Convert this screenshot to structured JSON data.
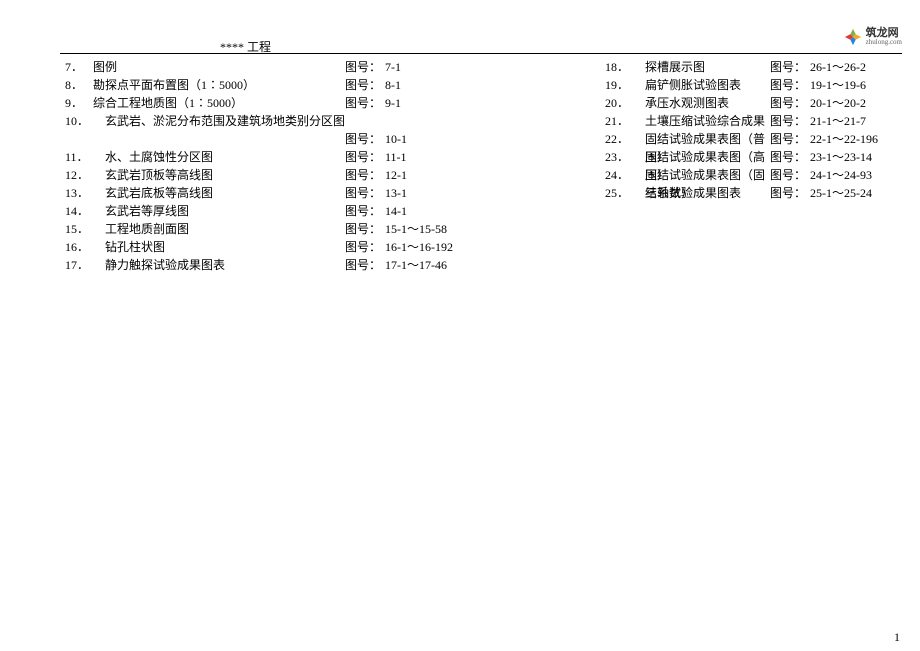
{
  "header": {
    "project_title": "**** 工程"
  },
  "logo": {
    "main": "筑龙网",
    "sub": "zhulong.com"
  },
  "page_number": "1",
  "figno_label": "图号：",
  "left_items": [
    {
      "idx": "7．",
      "title": "图例",
      "figno": "7-1"
    },
    {
      "idx": "8．",
      "title": "勘探点平面布置图（1∶5000）",
      "figno": "8-1"
    },
    {
      "idx": "9．",
      "title": "综合工程地质图（1∶5000）",
      "figno": "9-1"
    },
    {
      "idx": "10．",
      "title": "玄武岩、淤泥分布范围及建筑场地类别分区图",
      "figno": ""
    },
    {
      "idx": "",
      "title": "",
      "figno": "10-1"
    },
    {
      "idx": "11．",
      "title": "水、土腐蚀性分区图",
      "figno": "11-1"
    },
    {
      "idx": "12．",
      "title": "玄武岩顶板等高线图",
      "figno": "12-1"
    },
    {
      "idx": "13．",
      "title": "玄武岩底板等高线图",
      "figno": "13-1"
    },
    {
      "idx": "14．",
      "title": "玄武岩等厚线图",
      "figno": "14-1"
    },
    {
      "idx": "15．",
      "title": "工程地质剖面图",
      "figno": "15-1～15-58"
    },
    {
      "idx": "16．",
      "title": "钻孔柱状图",
      "figno": "16-1～16-192"
    },
    {
      "idx": "17．",
      "title": "静力触探试验成果图表",
      "figno": "17-1～17-46"
    }
  ],
  "right_items": [
    {
      "idx": "18．",
      "title": "探槽展示图",
      "figno": "26-1～26-2"
    },
    {
      "idx": "19．",
      "title": "扁铲侧胀试验图表",
      "figno": "19-1～19-6"
    },
    {
      "idx": "20．",
      "title": "承压水观测图表",
      "figno": "20-1～20-2"
    },
    {
      "idx": "21．",
      "title": "土壤压缩试验综合成果",
      "figno": "21-1～21-7"
    },
    {
      "idx": "22．",
      "title": "固结试验成果表图（普压）",
      "figno": "22-1～22-196"
    },
    {
      "idx": "23．",
      "title": "固结试验成果表图（高压）",
      "figno": "23-1～23-14"
    },
    {
      "idx": "24．",
      "title": "固结试验成果表图（固结系数）",
      "figno": "24-1～24-93"
    },
    {
      "idx": "25．",
      "title": "三轴试验成果图表",
      "figno": "25-1～25-24"
    }
  ]
}
